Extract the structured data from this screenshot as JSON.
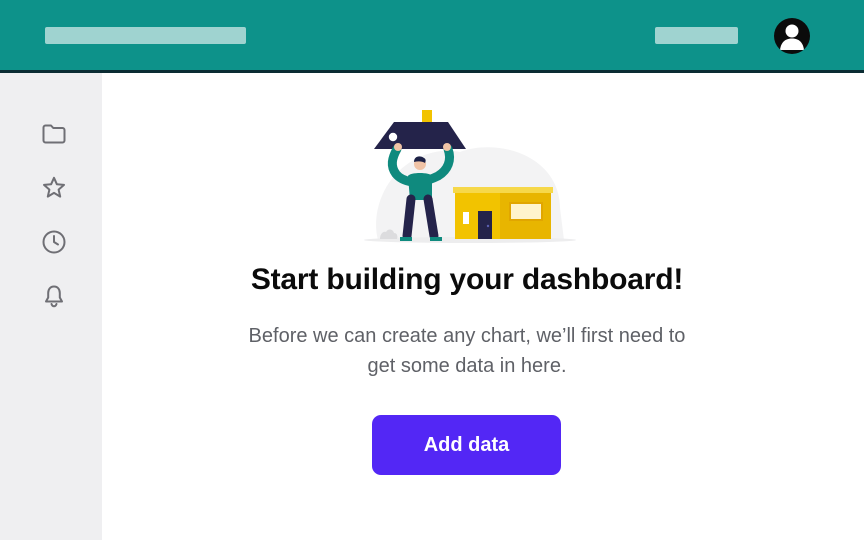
{
  "header": {
    "left_placeholder": "",
    "right_placeholder": "",
    "avatar_icon": "user-avatar-icon"
  },
  "sidebar": {
    "items": [
      {
        "icon": "folder-icon"
      },
      {
        "icon": "star-icon"
      },
      {
        "icon": "clock-icon"
      },
      {
        "icon": "bell-icon"
      }
    ]
  },
  "empty_state": {
    "illustration": "person-lifting-roof-house",
    "title": "Start building your dashboard!",
    "subtitle": "Before we can create any chart, we’ll first need to get some data in here.",
    "cta_label": "Add data"
  },
  "colors": {
    "header": "#0d928a",
    "header_border": "#0b2c33",
    "placeholder": "#9fd3d0",
    "sidebar": "#efeff1",
    "accent": "#5327f5",
    "house": "#f2c300",
    "roof": "#24234a"
  }
}
